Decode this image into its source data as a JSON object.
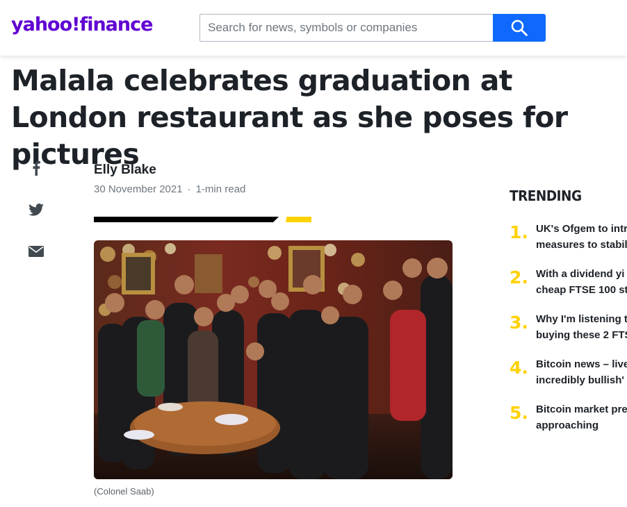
{
  "header": {
    "logo": "yahoo!finance",
    "search_placeholder": "Search for news, symbols or companies"
  },
  "article": {
    "headline": "Malala celebrates graduation at London restaurant as she poses for pictures",
    "author": "Elly Blake",
    "date": "30 November 2021",
    "separator": "·",
    "read_time": "1-min read",
    "photo_caption": "(Colonel Saab)"
  },
  "share_icons": [
    "facebook-icon",
    "twitter-icon",
    "mail-icon"
  ],
  "trending": {
    "title": "TRENDING",
    "items": [
      {
        "num": "1.",
        "line1": "UK's Ofgem to intr",
        "line2": "measures to stabil"
      },
      {
        "num": "2.",
        "line1": "With a dividend yi",
        "line2": "cheap FTSE 100 st"
      },
      {
        "num": "3.",
        "line1": "Why I'm listening t",
        "line2": "buying these 2 FTS"
      },
      {
        "num": "4.",
        "line1": "Bitcoin news – live",
        "line2": "incredibly bullish'"
      },
      {
        "num": "5.",
        "line1": "Bitcoin market pre",
        "line2": "approaching"
      }
    ]
  },
  "colors": {
    "brand_purple": "#6001d2",
    "search_blue": "#0f69ff",
    "accent_yellow": "#ffd200",
    "text_dark": "#1d2228"
  }
}
